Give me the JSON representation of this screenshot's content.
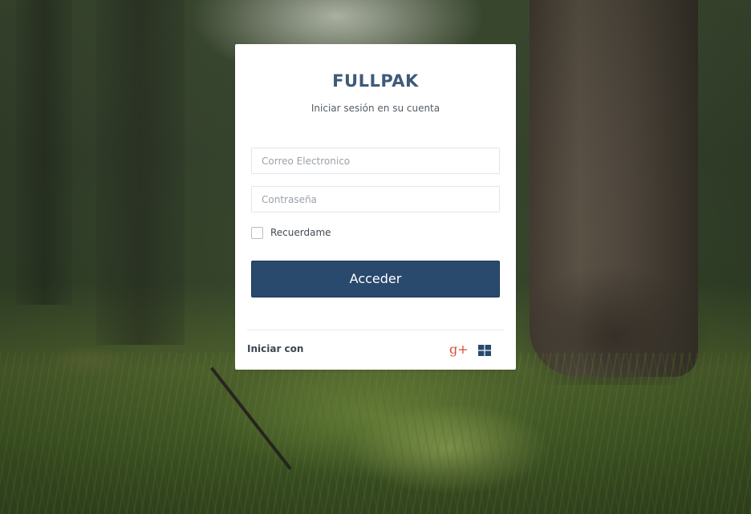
{
  "login": {
    "brand": "FULLPAK",
    "subtitle": "Iniciar sesión en su cuenta",
    "email_placeholder": "Correo Electronico",
    "password_placeholder": "Contraseña",
    "remember_label": "Recuerdame",
    "submit_label": "Acceder",
    "social_label": "Iniciar con"
  },
  "social": {
    "google_icon": "google-plus-icon",
    "windows_icon": "windows-icon",
    "google_glyph": "g+"
  },
  "colors": {
    "brand_text": "#3f5a7a",
    "button_bg": "#29496d",
    "google": "#dd4b39",
    "windows": "#29496d"
  }
}
